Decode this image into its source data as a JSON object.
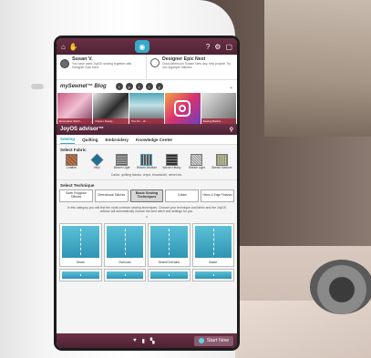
{
  "topbar": {
    "help": "?",
    "left_icons": [
      "home-icon",
      "hand-icon"
    ],
    "right_icons": [
      "help-icon",
      "settings-icon",
      "info-icon"
    ]
  },
  "user": {
    "name": "Susan V.",
    "text": "You have used JoyOS sewing together with Designer Epic Next."
  },
  "designer": {
    "title": "Designer Epic Next",
    "text": "Good Afternoon Susan! New day, new project! Try out: Applique Stitches"
  },
  "blog": {
    "title": "mySewnet™ Blog",
    "social": [
      "f",
      "p",
      "t",
      "i",
      "y"
    ],
    "thumbs": [
      {
        "caption": "Decorative Stitch..."
      },
      {
        "caption": "Clipper Ready..."
      },
      {
        "caption": "The Art ...of..."
      },
      {
        "caption": ""
      },
      {
        "caption": "Sewing Basics"
      }
    ]
  },
  "advisor": {
    "title": "JoyOS advisor™",
    "tabs": [
      "Sewing",
      "Quilting",
      "Embroidery",
      "Knowledge Center"
    ],
    "active_tab": "Sewing"
  },
  "select_fabric": {
    "label": "Select Fabric",
    "fabrics": [
      "Leather",
      "Vinyl",
      "Woven Light",
      "Woven Medium",
      "Woven Heavy",
      "Stretch Light",
      "Stretch Medium"
    ],
    "selected": "Woven Medium",
    "description": "Calico, quilting fabrics, crepe, broadcloth, velvet etc."
  },
  "select_technique": {
    "label": "Select Technique",
    "techniques": [
      "Saver Polygram Stitches",
      "Dimensional Stitches",
      "Basic Sewing Techniques",
      "Collars",
      "Hems & Edge Finishes"
    ],
    "active": "Basic Sewing Techniques",
    "description": "In this category you will find the most common sewing techniques. Choose your technique and fabric and the JoyOS advisor will automatically choose the best stitch and settings for you."
  },
  "stitches": [
    "Seam",
    "Overcast",
    "Seam/Overcast",
    "Baste"
  ],
  "bottombar": {
    "start_label": "Start Now"
  }
}
